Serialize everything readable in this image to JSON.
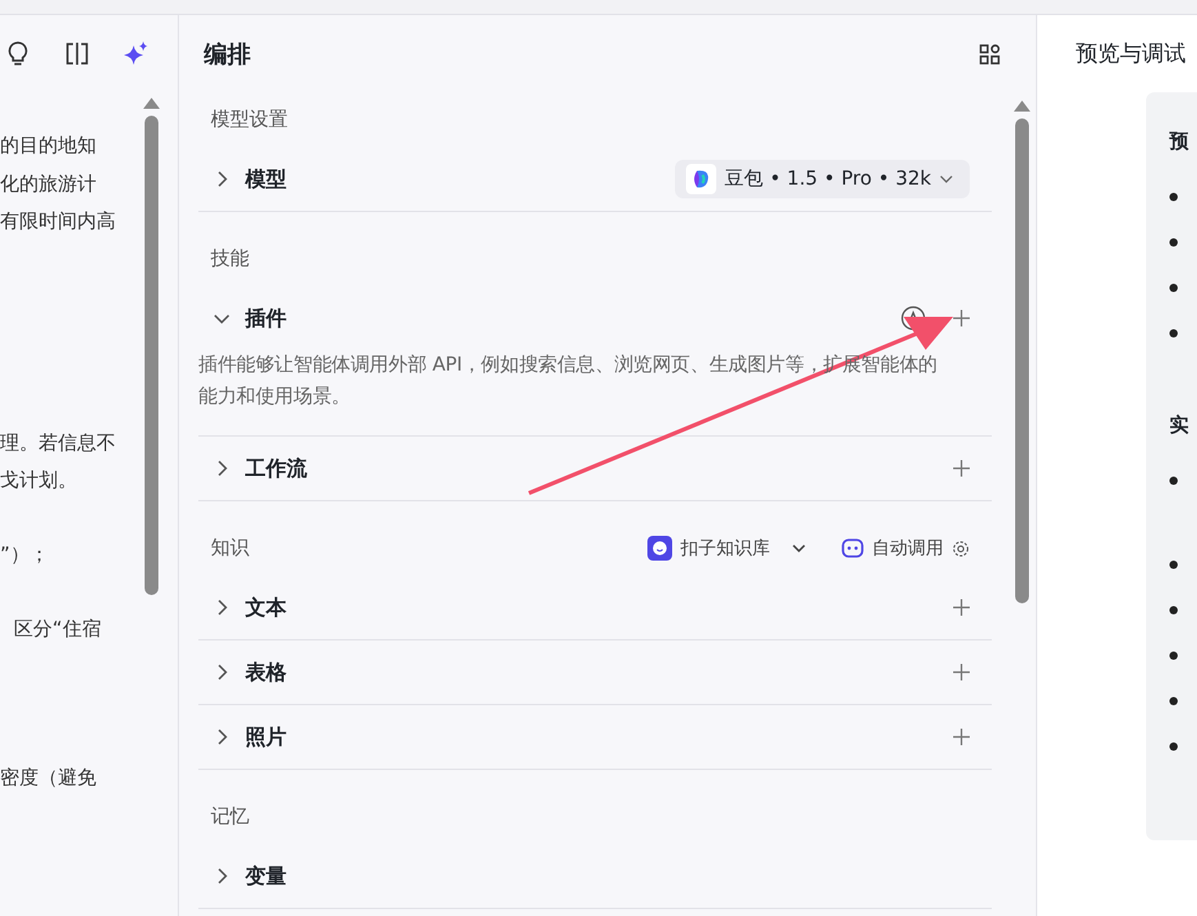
{
  "left_panel": {
    "toolbar": [
      {
        "kind": "bulb",
        "selected": false
      },
      {
        "kind": "split",
        "selected": false
      },
      {
        "kind": "sparkle",
        "selected": true
      }
    ],
    "paragraphs": [
      [
        "的目的地知",
        "化的旅游计",
        "有限时间内高"
      ],
      [
        "理。若信息不",
        "戈计划。"
      ],
      [
        "”）；"
      ],
      [
        "区分“住宿"
      ],
      [
        "密度（避免"
      ]
    ]
  },
  "editor": {
    "title": "编排",
    "sections": [
      {
        "label": "模型设置",
        "items": [
          {
            "kind": "model",
            "label": "模型",
            "expanded": false,
            "model": "豆包 • 1.5 • Pro • 32k"
          }
        ]
      },
      {
        "label": "技能",
        "items": [
          {
            "kind": "auto",
            "label": "插件",
            "expanded": true,
            "description": "插件能够让智能体调用外部 API，例如搜索信息、浏览网页、生成图片等，扩展智能体的能力和使用场景。"
          },
          {
            "kind": "add",
            "label": "工作流",
            "expanded": false
          }
        ]
      },
      {
        "label": "知识",
        "source": "扣子知识库",
        "call_mode": "自动调用",
        "items": [
          {
            "kind": "add",
            "label": "文本",
            "expanded": false
          },
          {
            "kind": "add",
            "label": "表格",
            "expanded": false
          },
          {
            "kind": "add",
            "label": "照片",
            "expanded": false
          }
        ]
      },
      {
        "label": "记忆",
        "items": [
          {
            "kind": "plain",
            "label": "变量",
            "expanded": false
          }
        ]
      }
    ]
  },
  "preview": {
    "title": "预览与调试",
    "blocks": [
      {
        "heading": "预",
        "bullets": [
          {
            "kind": "line"
          },
          {
            "kind": "line"
          },
          {
            "kind": "line"
          },
          {
            "kind": "line"
          }
        ]
      },
      {
        "heading": "实",
        "bullets": [
          {
            "kind": "double"
          },
          {
            "kind": "line"
          },
          {
            "kind": "line"
          },
          {
            "kind": "line"
          },
          {
            "kind": "line"
          },
          {
            "kind": "line"
          }
        ]
      }
    ]
  },
  "annotation": {
    "kind": "arrow"
  }
}
